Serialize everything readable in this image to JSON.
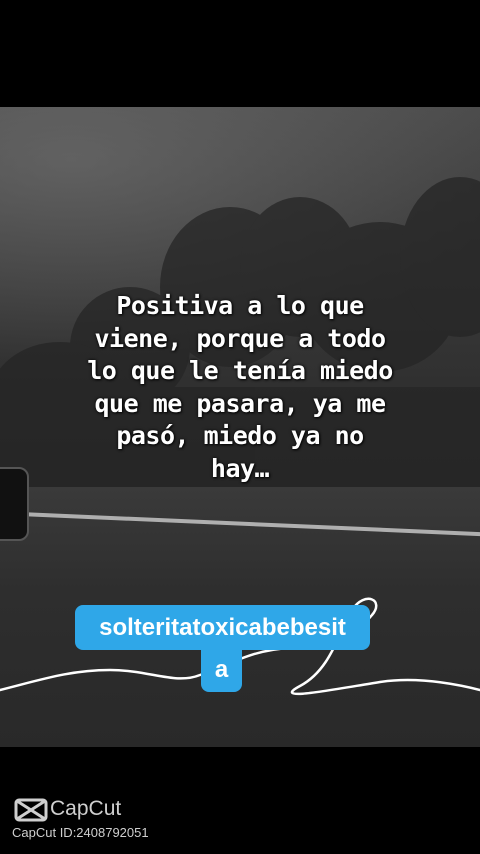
{
  "caption": {
    "lines": [
      "Positiva a lo que",
      "viene, porque a todo",
      "lo que le tenía miedo",
      "que me pasara, ya me",
      "pasó, miedo ya no",
      "hay…"
    ]
  },
  "username_tag": {
    "line1": "solteritatoxicabebesit",
    "line2": "a",
    "color": "#2fa7e8"
  },
  "watermark": {
    "brand": "CapCut",
    "id_text": "CapCut ID:2408792051",
    "icon": "capcut-logo-icon"
  }
}
